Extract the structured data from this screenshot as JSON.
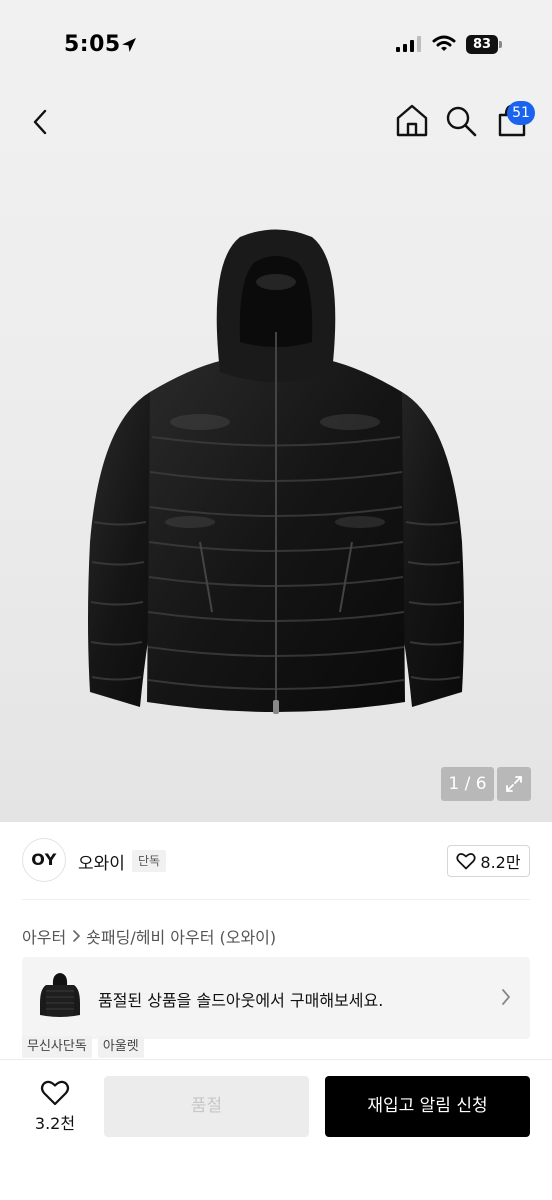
{
  "status_bar": {
    "time": "5:05",
    "battery": "83"
  },
  "nav": {
    "cart_badge": "51"
  },
  "gallery": {
    "pager": "1 / 6"
  },
  "brand": {
    "logo_text": "OY",
    "name": "오와이",
    "tag": "단독",
    "likes": "8.2만"
  },
  "breadcrumb": {
    "category": "아우터",
    "subcategory": "숏패딩/헤비 아우터 (오와이)"
  },
  "promo": {
    "text": "품절된 상품을 솔드아웃에서 구매해보세요."
  },
  "tags": [
    "무신사단독",
    "아울렛"
  ],
  "bottom_bar": {
    "wish_count": "3.2천",
    "soldout_label": "품절",
    "restock_label": "재입고 알림 신청"
  },
  "colors": {
    "badge": "#1a63ef",
    "primary_button": "#000000",
    "disabled_button": "#ececec"
  }
}
